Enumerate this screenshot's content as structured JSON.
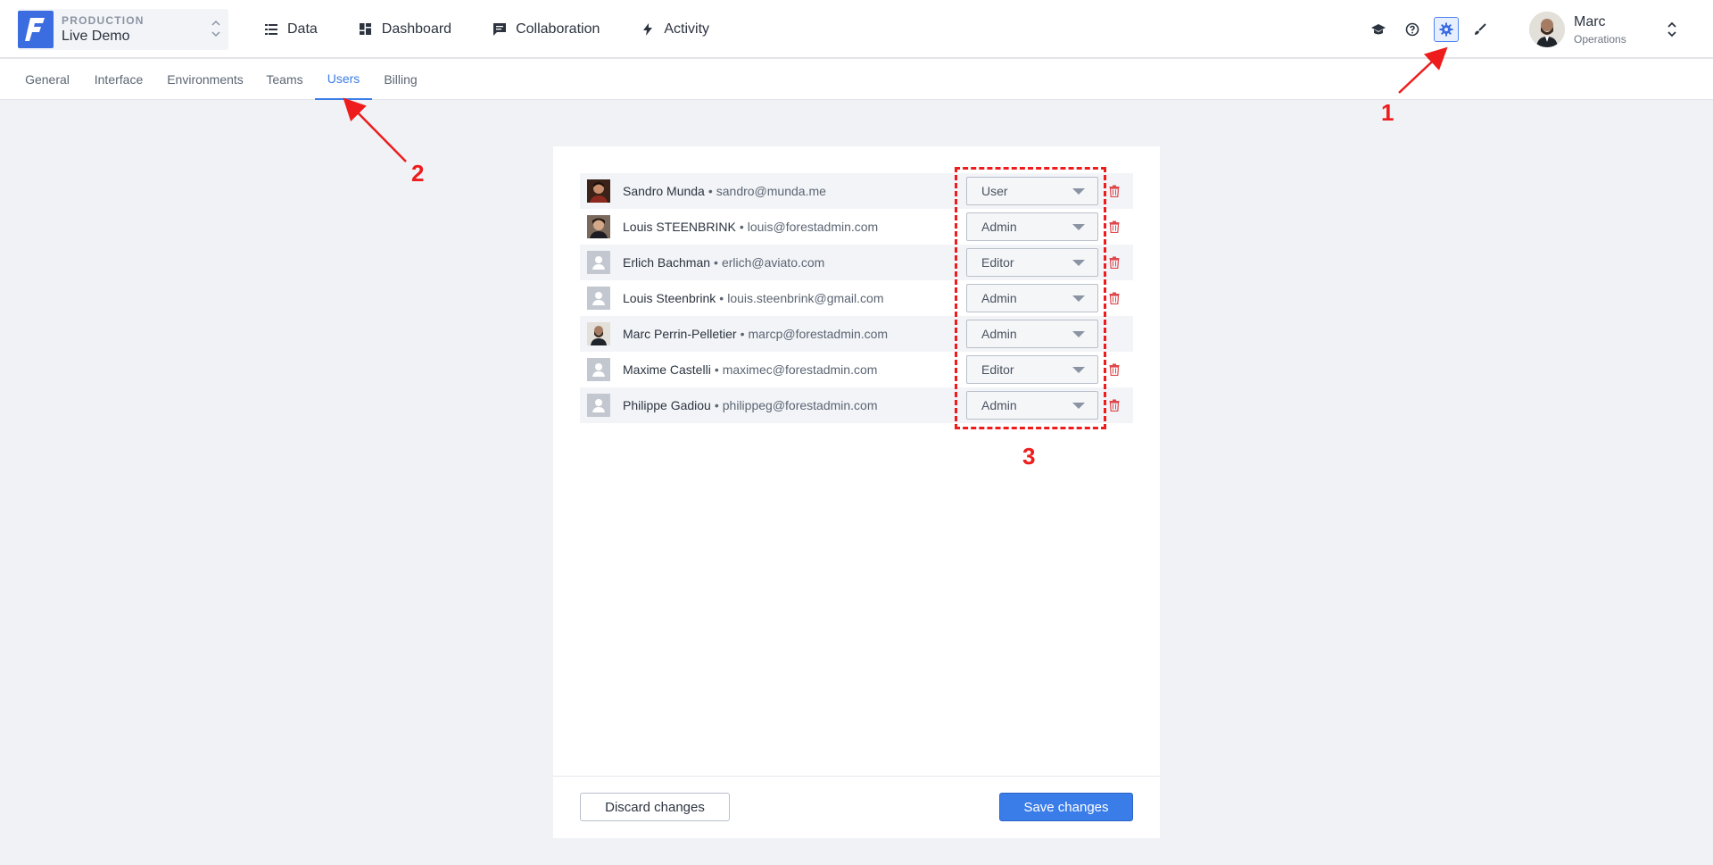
{
  "project": {
    "environment": "PRODUCTION",
    "name": "Live Demo"
  },
  "nav": [
    {
      "label": "Data",
      "icon": "list-icon"
    },
    {
      "label": "Dashboard",
      "icon": "dashboard-icon"
    },
    {
      "label": "Collaboration",
      "icon": "chat-icon"
    },
    {
      "label": "Activity",
      "icon": "bolt-icon"
    }
  ],
  "tools": [
    {
      "icon": "graduation-cap-icon"
    },
    {
      "icon": "help-icon"
    },
    {
      "icon": "gear-icon",
      "active": true
    },
    {
      "icon": "brush-icon"
    }
  ],
  "user": {
    "name": "Marc",
    "role": "Operations"
  },
  "subtabs": [
    {
      "label": "General"
    },
    {
      "label": "Interface"
    },
    {
      "label": "Environments"
    },
    {
      "label": "Teams"
    },
    {
      "label": "Users",
      "active": true
    },
    {
      "label": "Billing"
    }
  ],
  "users": [
    {
      "name": "Sandro Munda",
      "separator": "•",
      "email": "sandro@munda.me",
      "role": "User",
      "avatar": "photo",
      "deletable": true
    },
    {
      "name": "Louis STEENBRINK",
      "separator": "•",
      "email": "louis@forestadmin.com",
      "role": "Admin",
      "avatar": "photo",
      "deletable": true
    },
    {
      "name": "Erlich Bachman",
      "separator": "•",
      "email": "erlich@aviato.com",
      "role": "Editor",
      "avatar": "placeholder",
      "deletable": true
    },
    {
      "name": "Louis Steenbrink",
      "separator": "•",
      "email": "louis.steenbrink@gmail.com",
      "role": "Admin",
      "avatar": "placeholder",
      "deletable": true
    },
    {
      "name": "Marc Perrin-Pelletier",
      "separator": "•",
      "email": "marcp@forestadmin.com",
      "role": "Admin",
      "avatar": "photo",
      "deletable": false
    },
    {
      "name": "Maxime Castelli",
      "separator": "•",
      "email": "maximec@forestadmin.com",
      "role": "Editor",
      "avatar": "placeholder",
      "deletable": true
    },
    {
      "name": "Philippe Gadiou",
      "separator": "•",
      "email": "philippeg@forestadmin.com",
      "role": "Admin",
      "avatar": "placeholder",
      "deletable": true
    }
  ],
  "footer": {
    "discard_label": "Discard changes",
    "save_label": "Save changes"
  },
  "annotations": {
    "one": "1",
    "two": "2",
    "three": "3"
  },
  "colors": {
    "accent": "#3b7de8",
    "annotation": "#ee1c1c",
    "delete": "#e0474c"
  }
}
